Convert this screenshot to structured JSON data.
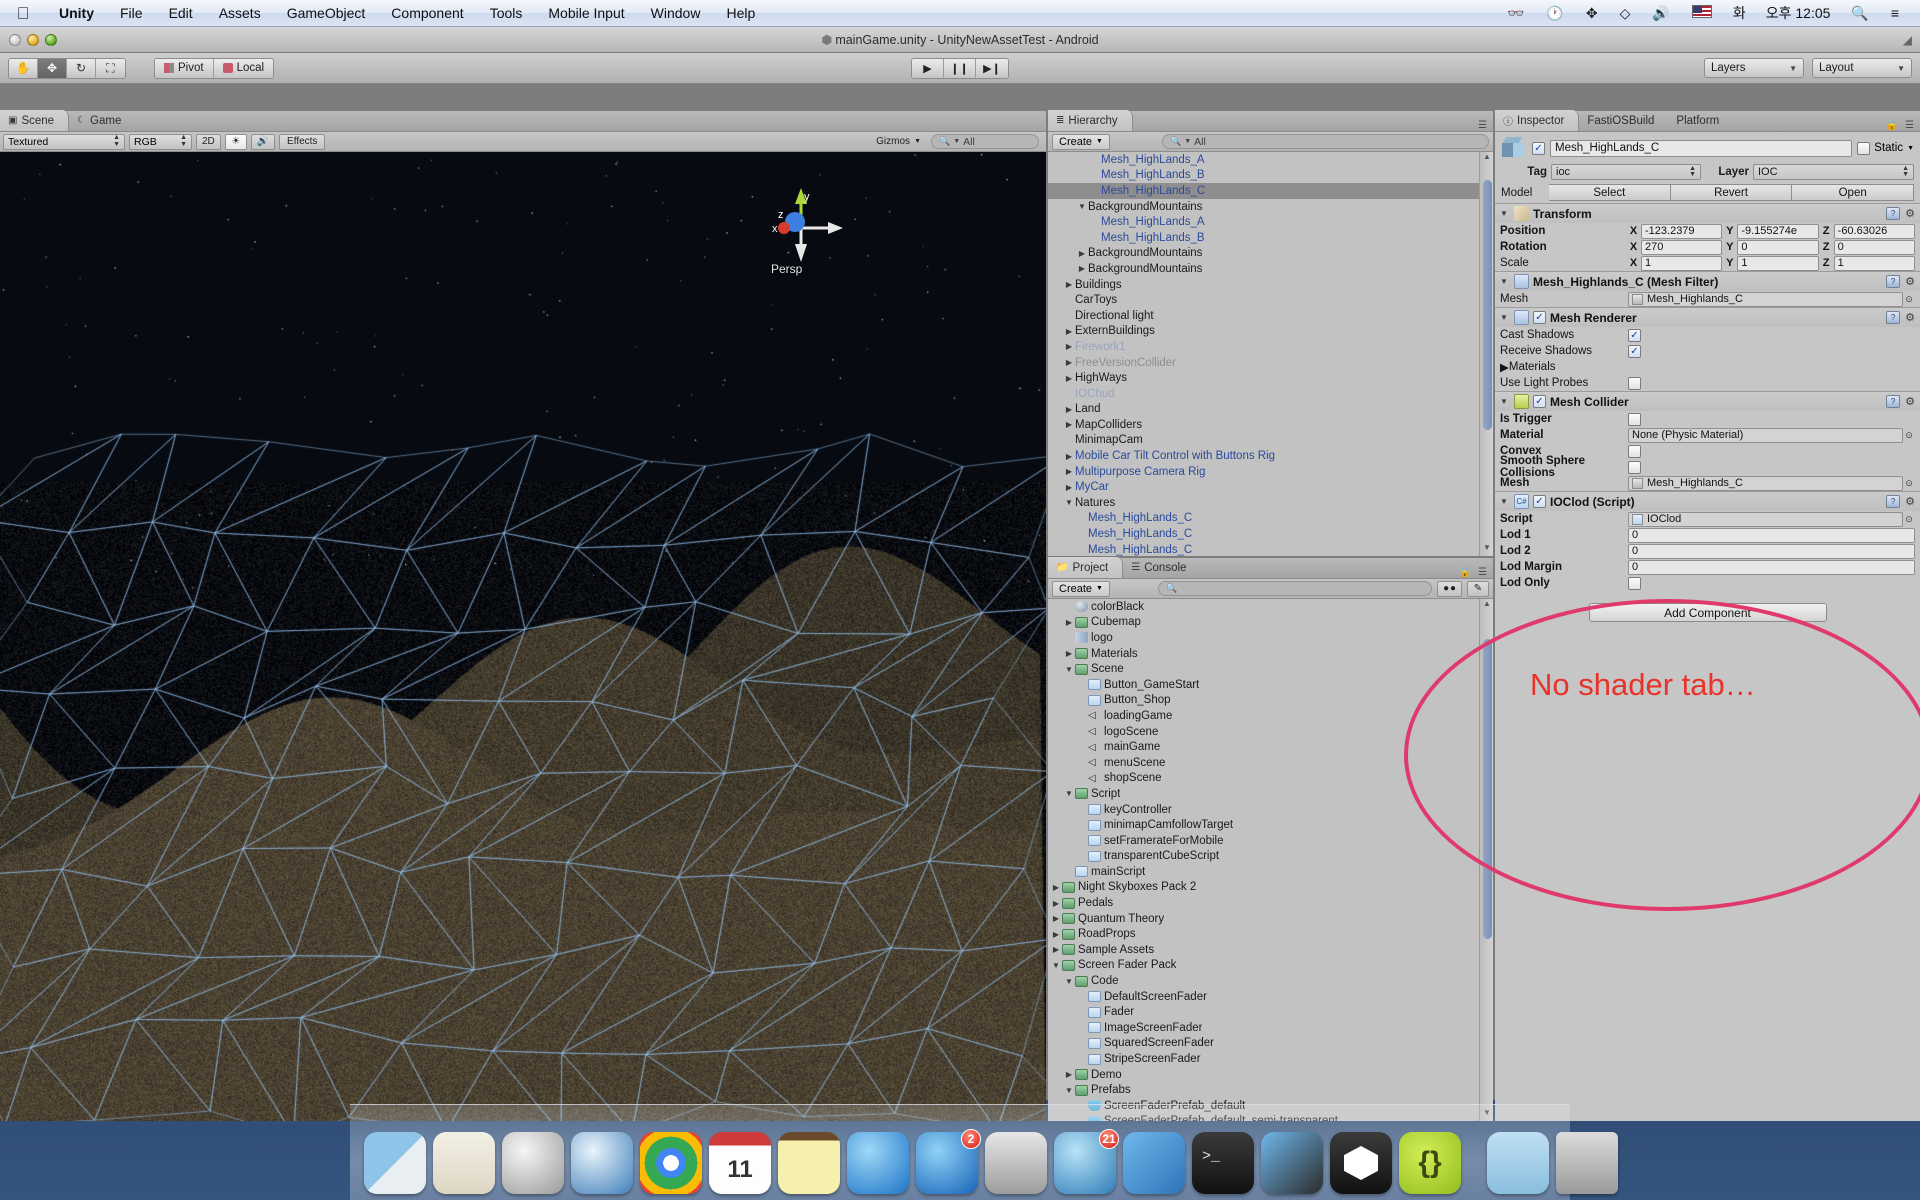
{
  "menubar": {
    "apple_icon": "apple-logo",
    "items": [
      {
        "label": "Unity",
        "bold": true
      },
      {
        "label": "File",
        "bold": false
      },
      {
        "label": "Edit",
        "bold": false
      },
      {
        "label": "Assets",
        "bold": false
      },
      {
        "label": "GameObject",
        "bold": false
      },
      {
        "label": "Component",
        "bold": false
      },
      {
        "label": "Tools",
        "bold": false
      },
      {
        "label": "Mobile Input",
        "bold": false
      },
      {
        "label": "Window",
        "bold": false
      },
      {
        "label": "Help",
        "bold": false
      }
    ],
    "status_icons": [
      "binoculars-icon",
      "timemachine-icon",
      "bluetooth-icon",
      "wifi-icon",
      "volume-icon",
      "us-flag-icon"
    ],
    "input_source": "화",
    "clock": "오후 12:05",
    "spotlight_icon": "search-icon",
    "notification_icon": "list-icon"
  },
  "window": {
    "title": "mainGame.unity - UnityNewAssetTest - Android",
    "title_icon": "unity-logo-icon",
    "lights": [
      "close-light",
      "minimize-light",
      "zoom-light"
    ]
  },
  "toolbar": {
    "transform_tools": [
      {
        "name": "hand-tool",
        "glyph": "✋",
        "active": false
      },
      {
        "name": "move-tool",
        "glyph": "✥",
        "active": true
      },
      {
        "name": "rotate-tool",
        "glyph": "↻",
        "active": false
      },
      {
        "name": "scale-tool",
        "glyph": "⛶",
        "active": false
      }
    ],
    "pivot_label": "Pivot",
    "local_label": "Local",
    "play_buttons": [
      {
        "name": "play-button",
        "glyph": "▶"
      },
      {
        "name": "pause-button",
        "glyph": "❙❙"
      },
      {
        "name": "step-button",
        "glyph": "▶❙"
      }
    ],
    "layers_label": "Layers",
    "layout_label": "Layout"
  },
  "scene_panel": {
    "tabs": [
      {
        "label": "Scene",
        "icon": "scene-grid-icon",
        "active": true
      },
      {
        "label": "Game",
        "icon": "game-moon-icon",
        "active": false
      }
    ],
    "draw_mode": "Textured",
    "color_mode": "RGB",
    "buttons_2d": "2D",
    "light_icon": "sun-icon",
    "audio_icon": "speaker-icon",
    "effects_label": "Effects",
    "gizmos_label": "Gizmos",
    "search_placeholder": "All",
    "gizmo_label": "Persp",
    "axis_labels": {
      "x": "x",
      "y": "y",
      "z": "z"
    }
  },
  "hierarchy": {
    "tab_label": "Hierarchy",
    "tab_icon": "hierarchy-icon",
    "create_label": "Create",
    "search_placeholder": "All",
    "rows": [
      {
        "label": "Mesh_HighLands_A",
        "indent": 3,
        "twisty": "",
        "style": "prefab",
        "selected": false
      },
      {
        "label": "Mesh_HighLands_B",
        "indent": 3,
        "twisty": "",
        "style": "prefab",
        "selected": false
      },
      {
        "label": "Mesh_HighLands_C",
        "indent": 3,
        "twisty": "",
        "style": "prefab",
        "selected": true
      },
      {
        "label": "BackgroundMountains",
        "indent": 2,
        "twisty": "▼",
        "style": "",
        "selected": false
      },
      {
        "label": "Mesh_HighLands_A",
        "indent": 3,
        "twisty": "",
        "style": "prefab",
        "selected": false
      },
      {
        "label": "Mesh_HighLands_B",
        "indent": 3,
        "twisty": "",
        "style": "prefab",
        "selected": false
      },
      {
        "label": "BackgroundMountains",
        "indent": 2,
        "twisty": "▶",
        "style": "",
        "selected": false
      },
      {
        "label": "BackgroundMountains",
        "indent": 2,
        "twisty": "▶",
        "style": "",
        "selected": false
      },
      {
        "label": "Buildings",
        "indent": 1,
        "twisty": "▶",
        "style": "",
        "selected": false
      },
      {
        "label": "CarToys",
        "indent": 1,
        "twisty": "",
        "style": "",
        "selected": false
      },
      {
        "label": "Directional light",
        "indent": 1,
        "twisty": "",
        "style": "",
        "selected": false
      },
      {
        "label": "ExternBuildings",
        "indent": 1,
        "twisty": "▶",
        "style": "",
        "selected": false
      },
      {
        "label": "Firework1",
        "indent": 1,
        "twisty": "▶",
        "style": "prefab dim",
        "selected": false
      },
      {
        "label": "FreeVersionCollider",
        "indent": 1,
        "twisty": "▶",
        "style": "dim",
        "selected": false
      },
      {
        "label": "HighWays",
        "indent": 1,
        "twisty": "▶",
        "style": "",
        "selected": false
      },
      {
        "label": "IOChud",
        "indent": 1,
        "twisty": "",
        "style": "prefab dim",
        "selected": false
      },
      {
        "label": "Land",
        "indent": 1,
        "twisty": "▶",
        "style": "",
        "selected": false
      },
      {
        "label": "MapColliders",
        "indent": 1,
        "twisty": "▶",
        "style": "",
        "selected": false
      },
      {
        "label": "MinimapCam",
        "indent": 1,
        "twisty": "",
        "style": "",
        "selected": false
      },
      {
        "label": "Mobile Car Tilt Control with Buttons Rig",
        "indent": 1,
        "twisty": "▶",
        "style": "prefab",
        "selected": false
      },
      {
        "label": "Multipurpose Camera Rig",
        "indent": 1,
        "twisty": "▶",
        "style": "prefab",
        "selected": false
      },
      {
        "label": "MyCar",
        "indent": 1,
        "twisty": "▶",
        "style": "prefab",
        "selected": false
      },
      {
        "label": "Natures",
        "indent": 1,
        "twisty": "▼",
        "style": "",
        "selected": false
      },
      {
        "label": "Mesh_HighLands_C",
        "indent": 2,
        "twisty": "",
        "style": "prefab",
        "selected": false
      },
      {
        "label": "Mesh_HighLands_C",
        "indent": 2,
        "twisty": "",
        "style": "prefab",
        "selected": false
      },
      {
        "label": "Mesh_HighLands_C",
        "indent": 2,
        "twisty": "",
        "style": "prefab",
        "selected": false
      }
    ]
  },
  "project": {
    "tabs": [
      {
        "label": "Project",
        "icon": "folder-icon",
        "active": true
      },
      {
        "label": "Console",
        "icon": "console-icon",
        "active": false
      }
    ],
    "create_label": "Create",
    "search_placeholder": "",
    "filter_icons": [
      "label-filter-icon",
      "type-filter-icon"
    ],
    "rows": [
      {
        "label": "colorBlack",
        "indent": 1,
        "twisty": "",
        "icon": "material-icon"
      },
      {
        "label": "Cubemap",
        "indent": 1,
        "twisty": "▶",
        "icon": "folder-icon"
      },
      {
        "label": "logo",
        "indent": 1,
        "twisty": "",
        "icon": "texture-icon"
      },
      {
        "label": "Materials",
        "indent": 1,
        "twisty": "▶",
        "icon": "folder-icon"
      },
      {
        "label": "Scene",
        "indent": 1,
        "twisty": "▼",
        "icon": "folder-icon"
      },
      {
        "label": "Button_GameStart",
        "indent": 2,
        "twisty": "",
        "icon": "csharp-icon"
      },
      {
        "label": "Button_Shop",
        "indent": 2,
        "twisty": "",
        "icon": "csharp-icon"
      },
      {
        "label": "loadingGame",
        "indent": 2,
        "twisty": "",
        "icon": "unity-scene-icon"
      },
      {
        "label": "logoScene",
        "indent": 2,
        "twisty": "",
        "icon": "unity-scene-icon"
      },
      {
        "label": "mainGame",
        "indent": 2,
        "twisty": "",
        "icon": "unity-scene-icon"
      },
      {
        "label": "menuScene",
        "indent": 2,
        "twisty": "",
        "icon": "unity-scene-icon"
      },
      {
        "label": "shopScene",
        "indent": 2,
        "twisty": "",
        "icon": "unity-scene-icon"
      },
      {
        "label": "Script",
        "indent": 1,
        "twisty": "▼",
        "icon": "folder-icon"
      },
      {
        "label": "keyController",
        "indent": 2,
        "twisty": "",
        "icon": "csharp-icon"
      },
      {
        "label": "minimapCamfollowTarget",
        "indent": 2,
        "twisty": "",
        "icon": "csharp-icon"
      },
      {
        "label": "setFramerateForMobile",
        "indent": 2,
        "twisty": "",
        "icon": "csharp-icon"
      },
      {
        "label": "transparentCubeScript",
        "indent": 2,
        "twisty": "",
        "icon": "csharp-icon"
      },
      {
        "label": "mainScript",
        "indent": 1,
        "twisty": "",
        "icon": "csharp-icon"
      },
      {
        "label": "Night Skyboxes Pack 2",
        "indent": 0,
        "twisty": "▶",
        "icon": "folder-icon"
      },
      {
        "label": "Pedals",
        "indent": 0,
        "twisty": "▶",
        "icon": "folder-icon"
      },
      {
        "label": "Quantum Theory",
        "indent": 0,
        "twisty": "▶",
        "icon": "folder-icon"
      },
      {
        "label": "RoadProps",
        "indent": 0,
        "twisty": "▶",
        "icon": "folder-icon"
      },
      {
        "label": "Sample Assets",
        "indent": 0,
        "twisty": "▶",
        "icon": "folder-icon"
      },
      {
        "label": "Screen Fader Pack",
        "indent": 0,
        "twisty": "▼",
        "icon": "folder-icon"
      },
      {
        "label": "Code",
        "indent": 1,
        "twisty": "▼",
        "icon": "folder-icon"
      },
      {
        "label": "DefaultScreenFader",
        "indent": 2,
        "twisty": "",
        "icon": "csharp-icon"
      },
      {
        "label": "Fader",
        "indent": 2,
        "twisty": "",
        "icon": "csharp-icon"
      },
      {
        "label": "ImageScreenFader",
        "indent": 2,
        "twisty": "",
        "icon": "csharp-icon"
      },
      {
        "label": "SquaredScreenFader",
        "indent": 2,
        "twisty": "",
        "icon": "csharp-icon"
      },
      {
        "label": "StripeScreenFader",
        "indent": 2,
        "twisty": "",
        "icon": "csharp-icon"
      },
      {
        "label": "Demo",
        "indent": 1,
        "twisty": "▶",
        "icon": "folder-icon"
      },
      {
        "label": "Prefabs",
        "indent": 1,
        "twisty": "▼",
        "icon": "folder-icon"
      },
      {
        "label": "ScreenFaderPrefab_default",
        "indent": 2,
        "twisty": "",
        "icon": "prefab-icon"
      },
      {
        "label": "ScreenFaderPrefab_default_semi-transparent",
        "indent": 2,
        "twisty": "",
        "icon": "prefab-icon"
      }
    ]
  },
  "inspector": {
    "tabs": [
      {
        "label": "Inspector",
        "icon": "inspector-icon",
        "active": true
      },
      {
        "label": "FastiOSBuild",
        "icon": "",
        "active": false
      },
      {
        "label": "Platform",
        "icon": "",
        "active": false
      }
    ],
    "lock_icon": "lock-icon",
    "menu_icon": "panel-menu-icon",
    "object_name": "Mesh_HighLands_C",
    "object_enabled": true,
    "static_label": "Static",
    "static_checked": false,
    "tag_label": "Tag",
    "tag_value": "ioc",
    "layer_label": "Layer",
    "layer_value": "IOC",
    "model_label": "Model",
    "model_buttons": [
      "Select",
      "Revert",
      "Open"
    ],
    "components": [
      {
        "title": "Transform",
        "icon": "transform-icon",
        "has_checkbox": false,
        "rows": [
          {
            "name": "Position",
            "bold": true,
            "type": "vector3",
            "x": "-123.2379",
            "y": "-9.155274e",
            "z": "-60.63026"
          },
          {
            "name": "Rotation",
            "bold": true,
            "type": "vector3",
            "x": "270",
            "y": "0",
            "z": "0"
          },
          {
            "name": "Scale",
            "bold": false,
            "type": "vector3",
            "x": "1",
            "y": "1",
            "z": "1"
          }
        ]
      },
      {
        "title": "Mesh_Highlands_C (Mesh Filter)",
        "icon": "meshfilter-icon",
        "has_checkbox": false,
        "rows": [
          {
            "name": "Mesh",
            "bold": false,
            "type": "object",
            "value": "Mesh_Highlands_C"
          }
        ]
      },
      {
        "title": "Mesh Renderer",
        "icon": "meshrenderer-icon",
        "has_checkbox": true,
        "checked": true,
        "rows": [
          {
            "name": "Cast Shadows",
            "bold": false,
            "type": "checkbox",
            "checked": true
          },
          {
            "name": "Receive Shadows",
            "bold": false,
            "type": "checkbox",
            "checked": true
          },
          {
            "name": "Materials",
            "bold": false,
            "type": "foldout"
          },
          {
            "name": "Use Light Probes",
            "bold": false,
            "type": "checkbox",
            "checked": false
          }
        ]
      },
      {
        "title": "Mesh Collider",
        "icon": "meshcollider-icon",
        "has_checkbox": true,
        "checked": true,
        "rows": [
          {
            "name": "Is Trigger",
            "bold": true,
            "type": "checkbox",
            "checked": false
          },
          {
            "name": "Material",
            "bold": true,
            "type": "object",
            "value": "None (Physic Material)",
            "no_icon": true
          },
          {
            "name": "Convex",
            "bold": true,
            "type": "checkbox",
            "checked": false
          },
          {
            "name": "Smooth Sphere Collisions",
            "bold": true,
            "type": "checkbox",
            "checked": false
          },
          {
            "name": "Mesh",
            "bold": true,
            "type": "object",
            "value": "Mesh_Highlands_C"
          }
        ]
      },
      {
        "title": "IOClod (Script)",
        "icon": "script-icon",
        "has_checkbox": true,
        "checked": true,
        "rows": [
          {
            "name": "Script",
            "bold": true,
            "type": "object",
            "value": "IOClod",
            "script": true
          },
          {
            "name": "Lod 1",
            "bold": true,
            "type": "number",
            "value": "0"
          },
          {
            "name": "Lod 2",
            "bold": true,
            "type": "number",
            "value": "0"
          },
          {
            "name": "Lod Margin",
            "bold": true,
            "type": "number",
            "value": "0"
          },
          {
            "name": "Lod Only",
            "bold": true,
            "type": "checkbox",
            "checked": false
          }
        ]
      }
    ],
    "add_component_label": "Add Component"
  },
  "annotation": {
    "text": "No shader tab…",
    "circle_color": "#e03a6d",
    "text_color": "#e8322a"
  },
  "dock": {
    "items": [
      {
        "name": "finder",
        "badge": null
      },
      {
        "name": "mail",
        "badge": null
      },
      {
        "name": "launchpad",
        "badge": null
      },
      {
        "name": "safari",
        "badge": null
      },
      {
        "name": "chrome",
        "badge": null
      },
      {
        "name": "calendar",
        "badge": null,
        "day": "11"
      },
      {
        "name": "notes",
        "badge": null
      },
      {
        "name": "itunes",
        "badge": null
      },
      {
        "name": "app-store",
        "badge": "2"
      },
      {
        "name": "system-preferences",
        "badge": null
      },
      {
        "name": "network-utility",
        "badge": "21"
      },
      {
        "name": "xcode",
        "badge": null
      },
      {
        "name": "terminal",
        "badge": null
      },
      {
        "name": "xcode-simulator",
        "badge": null
      },
      {
        "name": "unity",
        "badge": null
      },
      {
        "name": "sublime-text",
        "badge": null
      },
      {
        "name": "downloads-folder",
        "badge": null
      },
      {
        "name": "trash",
        "badge": null
      }
    ]
  }
}
